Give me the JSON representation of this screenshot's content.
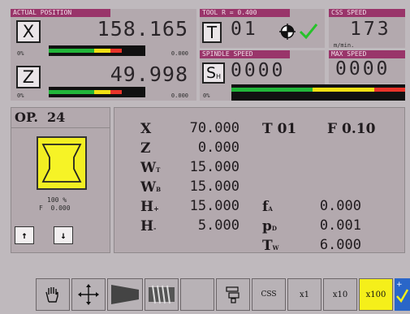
{
  "position": {
    "header": "ACTUAL POSITION",
    "x": {
      "axis": "X",
      "value": "158.165",
      "pct": "0%",
      "sub": "0.000"
    },
    "z": {
      "axis": "Z",
      "value": "49.998",
      "pct": "0%",
      "sub": "0.000"
    }
  },
  "tool": {
    "header": "TOOL  R = 0.400",
    "button": "T",
    "number": "01"
  },
  "spindle": {
    "header": "SPINDLE SPEED",
    "button": "S",
    "button_sub": "H",
    "value": "0000",
    "pct": "0%"
  },
  "css": {
    "header": "CSS SPEED",
    "value": "173",
    "unit": "m/min."
  },
  "max_speed": {
    "header": "MAX SPEED",
    "value": "0000"
  },
  "operation": {
    "title": "OP.  24",
    "override_pct": "100 %",
    "feed": "F  0.000",
    "up_label": "↑",
    "down_label": "↓"
  },
  "program": {
    "rows": [
      {
        "label": "X",
        "sub": "",
        "value": "70.000"
      },
      {
        "label": "Z",
        "sub": "",
        "value": "0.000"
      },
      {
        "label": "W",
        "sub": "T",
        "value": "15.000"
      },
      {
        "label": "W",
        "sub": "B",
        "value": "15.000"
      },
      {
        "label": "H",
        "sub": "+",
        "value": "15.000"
      },
      {
        "label": "H",
        "sub": "-",
        "value": "5.000"
      }
    ],
    "tool_label": "T 01",
    "feed_label": "F 0.10",
    "params": [
      {
        "label": "f",
        "sub": "A",
        "value": "0.000"
      },
      {
        "label": "p",
        "sub": "D",
        "value": "0.001"
      },
      {
        "label": "T",
        "sub": "W",
        "value": "6.000"
      }
    ]
  },
  "toolbar": {
    "css": "CSS",
    "x1": "x1",
    "x10": "x10",
    "x100": "x100"
  },
  "colors": {
    "header": "#99356a",
    "selected": "#f5ef1a",
    "check": "#26c22a"
  }
}
